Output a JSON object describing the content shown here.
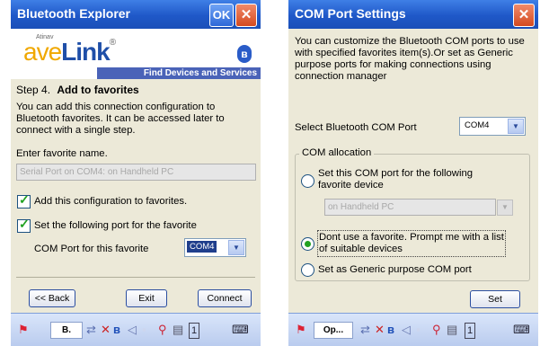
{
  "left": {
    "title": "Bluetooth Explorer",
    "ok_label": "OK",
    "close_label": "✕",
    "brand_small": "Atinav",
    "brand_logo_part1": "ave",
    "brand_logo_part2": "Link",
    "brand_trademark": "®",
    "brand_bar": "Find Devices and Services",
    "step_prefix": "Step 4.",
    "step_title": "Add to favorites",
    "description": "You can add this connection configuration to Bluetooth favorites. It can be accessed later to connect with a single step.",
    "name_label": "Enter favorite name.",
    "name_value": "Serial Port on COM4: on Handheld PC",
    "add_config_label": "Add this configuration to favorites.",
    "set_port_label": "Set the following port for the favorite",
    "com_port_label": "COM Port for this favorite",
    "com_port_value": "COM4",
    "back_label": "<< Back",
    "exit_label": "Exit",
    "connect_label": "Connect",
    "taskbar_text": "B."
  },
  "right": {
    "title": "COM Port Settings",
    "close_label": "✕",
    "description": "You can customize the Bluetooth COM ports to use with  specified favorites item(s).Or set as  Generic purpose ports for making connections using connection manager",
    "select_port_label": "Select Bluetooth COM Port",
    "select_port_value": "COM4",
    "group_label": "COM allocation",
    "radio1_label": "Set this COM port for the following favorite device",
    "device_value": "on Handheld PC",
    "radio2_label": "Dont use a favorite. Prompt me with a list of suitable devices",
    "radio3_label": "Set as Generic purpose COM port",
    "set_label": "Set",
    "taskbar_text": "Op..."
  },
  "icons": [
    "start-flag-icon",
    "bluetooth-icon",
    "network-icon",
    "volume-icon",
    "calendar-icon",
    "keyboard-icon"
  ],
  "colors": {
    "title_bar": "#1f58c8",
    "content_bg": "#ece9d8",
    "checkbox_tick": "#21a121"
  }
}
